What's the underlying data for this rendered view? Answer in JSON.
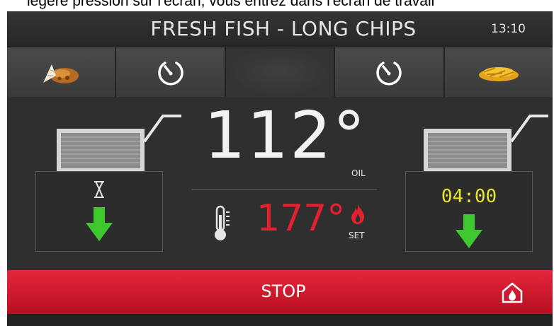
{
  "caption": "légère pression sur l'écran, vous entrez dans l'écran de travail",
  "header": {
    "title": "FRESH FISH - LONG CHIPS",
    "clock": "13:10"
  },
  "tabs": [
    {
      "icon": "fish-icon"
    },
    {
      "icon": "timer-icon"
    },
    {
      "icon": "blank"
    },
    {
      "icon": "timer-icon"
    },
    {
      "icon": "fries-icon"
    }
  ],
  "oil": {
    "temperature": "112°",
    "label": "OIL"
  },
  "setpoint": {
    "temperature": "177°",
    "label": "SET",
    "color": "#e3202e"
  },
  "left_basket": {
    "icon": "hourglass-icon",
    "action_icon": "arrow-down-icon"
  },
  "right_basket": {
    "timer": "04:00",
    "timer_color": "#e8e62c",
    "action_icon": "arrow-down-icon"
  },
  "stop_bar": {
    "label": "STOP",
    "color": "#e4263a",
    "home_icon": "home-icon"
  }
}
